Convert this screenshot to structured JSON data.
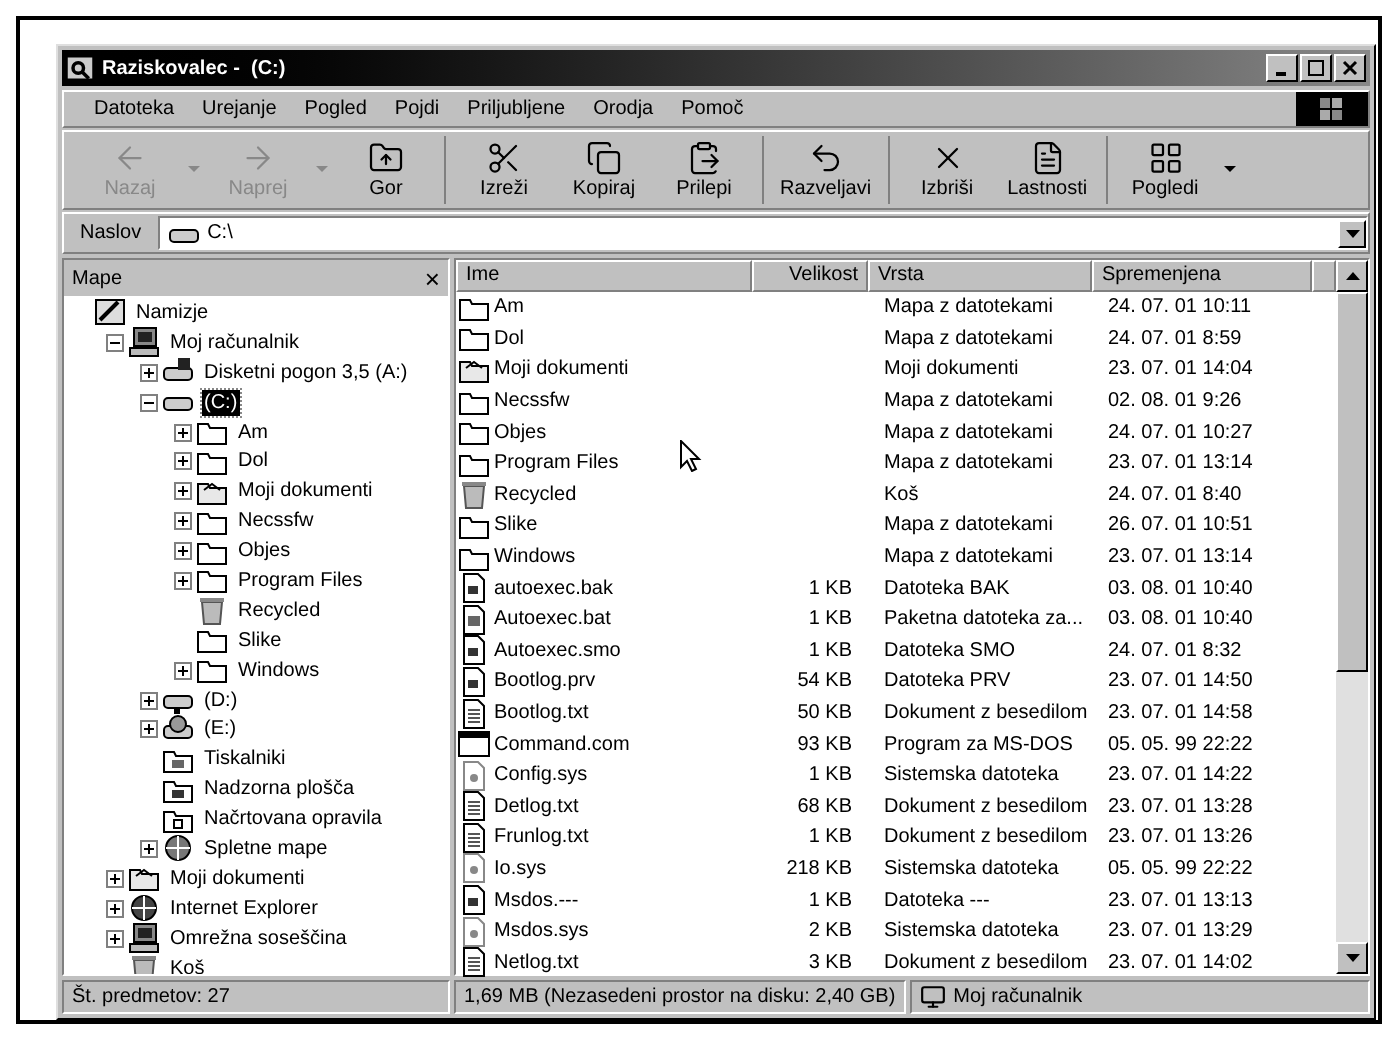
{
  "window": {
    "title": "Raziskovalec -  (C:)"
  },
  "menu": [
    "Datoteka",
    "Urejanje",
    "Pogled",
    "Pojdi",
    "Priljubljene",
    "Orodja",
    "Pomoč"
  ],
  "toolbar": [
    [
      {
        "label": "Nazaj",
        "kind": "back",
        "disabled": true,
        "dropdown": true
      },
      {
        "label": "Naprej",
        "kind": "forward",
        "disabled": true,
        "dropdown": true
      },
      {
        "label": "Gor",
        "kind": "up",
        "disabled": false,
        "dropdown": false
      }
    ],
    [
      {
        "label": "Izreži",
        "kind": "cut",
        "disabled": false,
        "dropdown": false
      },
      {
        "label": "Kopiraj",
        "kind": "copy",
        "disabled": false,
        "dropdown": false
      },
      {
        "label": "Prilepi",
        "kind": "paste",
        "disabled": false,
        "dropdown": false
      }
    ],
    [
      {
        "label": "Razveljavi",
        "kind": "undo",
        "disabled": false,
        "dropdown": false
      }
    ],
    [
      {
        "label": "Izbriši",
        "kind": "delete",
        "disabled": false,
        "dropdown": false
      },
      {
        "label": "Lastnosti",
        "kind": "properties",
        "disabled": false,
        "dropdown": false
      }
    ],
    [
      {
        "label": "Pogledi",
        "kind": "views",
        "disabled": false,
        "dropdown": true
      }
    ]
  ],
  "address": {
    "label": "Naslov",
    "value": "C:\\"
  },
  "tree": {
    "title": "Mape",
    "close": "×",
    "items": [
      {
        "label": "Namizje",
        "kind": "desktop",
        "selected": false,
        "children": [
          {
            "label": "Moj računalnik",
            "kind": "computer",
            "expandable": true,
            "expanded": true,
            "selected": false,
            "children": [
              {
                "label": "Disketni pogon 3,5 (A:)",
                "kind": "floppy",
                "expandable": true,
                "expanded": false,
                "selected": false
              },
              {
                "label": "(C:)",
                "kind": "drive",
                "expandable": true,
                "expanded": true,
                "selected": true,
                "children": [
                  {
                    "label": "Am",
                    "kind": "folder",
                    "expandable": true,
                    "expanded": false,
                    "selected": false
                  },
                  {
                    "label": "Dol",
                    "kind": "folder",
                    "expandable": true,
                    "expanded": false,
                    "selected": false
                  },
                  {
                    "label": "Moji dokumenti",
                    "kind": "mydocs",
                    "expandable": true,
                    "expanded": false,
                    "selected": false
                  },
                  {
                    "label": "Necssfw",
                    "kind": "folder",
                    "expandable": true,
                    "expanded": false,
                    "selected": false
                  },
                  {
                    "label": "Objes",
                    "kind": "folder",
                    "expandable": true,
                    "expanded": false,
                    "selected": false
                  },
                  {
                    "label": "Program Files",
                    "kind": "folder",
                    "expandable": true,
                    "expanded": false,
                    "selected": false
                  },
                  {
                    "label": "Recycled",
                    "kind": "recycle",
                    "expandable": false,
                    "expanded": false,
                    "selected": false
                  },
                  {
                    "label": "Slike",
                    "kind": "folder",
                    "expandable": false,
                    "expanded": false,
                    "selected": false
                  },
                  {
                    "label": "Windows",
                    "kind": "folder",
                    "expandable": true,
                    "expanded": false,
                    "selected": false
                  }
                ]
              },
              {
                "label": "(D:)",
                "kind": "netdrive",
                "expandable": true,
                "expanded": false,
                "selected": false
              },
              {
                "label": "(E:)",
                "kind": "cdrom",
                "expandable": true,
                "expanded": false,
                "selected": false
              },
              {
                "label": "Tiskalniki",
                "kind": "printers",
                "expandable": false,
                "expanded": false,
                "selected": false
              },
              {
                "label": "Nadzorna plošča",
                "kind": "control",
                "expandable": false,
                "expanded": false,
                "selected": false
              },
              {
                "label": "Načrtovana opravila",
                "kind": "tasks",
                "expandable": false,
                "expanded": false,
                "selected": false
              },
              {
                "label": "Spletne mape",
                "kind": "web",
                "expandable": true,
                "expanded": false,
                "selected": false
              }
            ]
          },
          {
            "label": "Moji dokumenti",
            "kind": "mydocs",
            "expandable": true,
            "expanded": false,
            "selected": false
          },
          {
            "label": "Internet Explorer",
            "kind": "ie",
            "expandable": true,
            "expanded": false,
            "selected": false
          },
          {
            "label": "Omrežna soseščina",
            "kind": "network",
            "expandable": true,
            "expanded": false,
            "selected": false
          },
          {
            "label": "Koš",
            "kind": "recycle",
            "expandable": false,
            "expanded": false,
            "selected": false
          }
        ]
      }
    ]
  },
  "table": {
    "columns": [
      "Ime",
      "Velikost",
      "Vrsta",
      "Spremenjena"
    ],
    "rows": [
      {
        "kind": "folder",
        "name": "Am",
        "size": "",
        "type": "Mapa z datotekami",
        "modified": "24. 07. 01 10:11"
      },
      {
        "kind": "folder",
        "name": "Dol",
        "size": "",
        "type": "Mapa z datotekami",
        "modified": "24. 07. 01 8:59"
      },
      {
        "kind": "mydocs",
        "name": "Moji dokumenti",
        "size": "",
        "type": "Moji dokumenti",
        "modified": "23. 07. 01 14:04"
      },
      {
        "kind": "folder",
        "name": "Necssfw",
        "size": "",
        "type": "Mapa z datotekami",
        "modified": "02. 08. 01 9:26"
      },
      {
        "kind": "folder",
        "name": "Objes",
        "size": "",
        "type": "Mapa z datotekami",
        "modified": "24. 07. 01 10:27"
      },
      {
        "kind": "folder",
        "name": "Program Files",
        "size": "",
        "type": "Mapa z datotekami",
        "modified": "23. 07. 01 13:14"
      },
      {
        "kind": "recycle",
        "name": "Recycled",
        "size": "",
        "type": "Koš",
        "modified": "24. 07. 01 8:40"
      },
      {
        "kind": "folder",
        "name": "Slike",
        "size": "",
        "type": "Mapa z datotekami",
        "modified": "26. 07. 01 10:51"
      },
      {
        "kind": "folder",
        "name": "Windows",
        "size": "",
        "type": "Mapa z datotekami",
        "modified": "23. 07. 01 13:14"
      },
      {
        "kind": "file",
        "name": "autoexec.bak",
        "size": "1 KB",
        "type": "Datoteka BAK",
        "modified": "03. 08. 01 10:40"
      },
      {
        "kind": "batch",
        "name": "Autoexec.bat",
        "size": "1 KB",
        "type": "Paketna datoteka za...",
        "modified": "03. 08. 01 10:40"
      },
      {
        "kind": "file",
        "name": "Autoexec.smo",
        "size": "1 KB",
        "type": "Datoteka SMO",
        "modified": "24. 07. 01 8:32"
      },
      {
        "kind": "file",
        "name": "Bootlog.prv",
        "size": "54 KB",
        "type": "Datoteka PRV",
        "modified": "23. 07. 01 14:50"
      },
      {
        "kind": "text",
        "name": "Bootlog.txt",
        "size": "50 KB",
        "type": "Dokument z besedilom",
        "modified": "23. 07. 01 14:58"
      },
      {
        "kind": "console",
        "name": "Command.com",
        "size": "93 KB",
        "type": "Program za MS-DOS",
        "modified": "05. 05. 99 22:22"
      },
      {
        "kind": "system",
        "name": "Config.sys",
        "size": "1 KB",
        "type": "Sistemska datoteka",
        "modified": "23. 07. 01 14:22"
      },
      {
        "kind": "text",
        "name": "Detlog.txt",
        "size": "68 KB",
        "type": "Dokument z besedilom",
        "modified": "23. 07. 01 13:28"
      },
      {
        "kind": "text",
        "name": "Frunlog.txt",
        "size": "1 KB",
        "type": "Dokument z besedilom",
        "modified": "23. 07. 01 13:26"
      },
      {
        "kind": "system",
        "name": "Io.sys",
        "size": "218 KB",
        "type": "Sistemska datoteka",
        "modified": "05. 05. 99 22:22"
      },
      {
        "kind": "file",
        "name": "Msdos.---",
        "size": "1 KB",
        "type": "Datoteka ---",
        "modified": "23. 07. 01 13:13"
      },
      {
        "kind": "system",
        "name": "Msdos.sys",
        "size": "2 KB",
        "type": "Sistemska datoteka",
        "modified": "23. 07. 01 13:29"
      },
      {
        "kind": "text",
        "name": "Netlog.txt",
        "size": "3 KB",
        "type": "Dokument z besedilom",
        "modified": "23. 07. 01 14:02"
      }
    ]
  },
  "status_bar": {
    "count": "Št. predmetov: 27",
    "size": "1,69 MB (Nezasedeni prostor na disku: 2,40 GB)",
    "location": "Moj računalnik"
  }
}
